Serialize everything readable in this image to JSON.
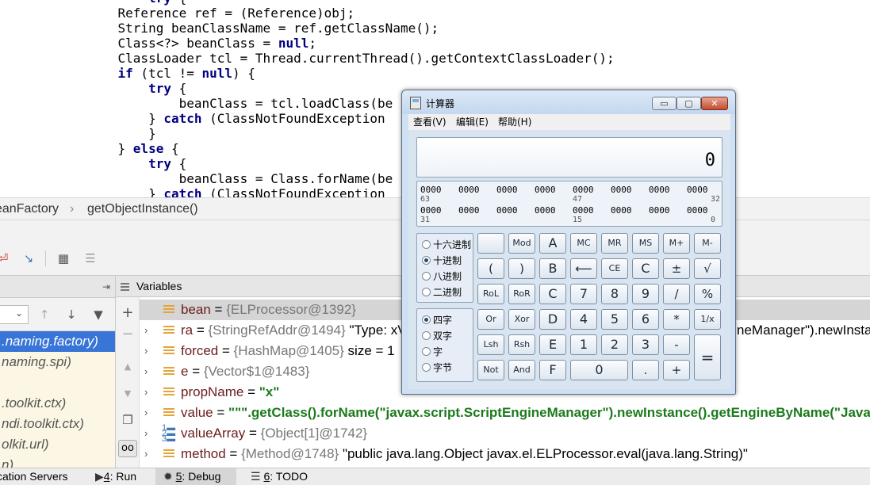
{
  "editor": {
    "lines": [
      {
        "indent": "        ",
        "kw": "try",
        "text": " {"
      },
      {
        "indent": "    ",
        "kw": "",
        "text": "Reference ref = (Reference)obj;"
      },
      {
        "indent": "    ",
        "kw": "",
        "text": "String beanClassName = ref.getClassName();"
      },
      {
        "indent": "    ",
        "kw": "",
        "text": "Class<?> beanClass = ",
        "kw2": "null",
        "tail": ";"
      },
      {
        "indent": "    ",
        "kw": "",
        "text": "ClassLoader tcl = Thread.currentThread().getContextClassLoader();"
      },
      {
        "indent": "    ",
        "kw": "if",
        "text": " (tcl != ",
        "kw2": "null",
        "tail": ") {"
      },
      {
        "indent": "        ",
        "kw": "try",
        "text": " {"
      },
      {
        "indent": "            ",
        "kw": "",
        "text": "beanClass = tcl.loadClass(be"
      },
      {
        "indent": "        ",
        "kw": "",
        "text": "} ",
        "kw2": "catch",
        "tail": " (ClassNotFoundException"
      },
      {
        "indent": "        ",
        "kw": "",
        "text": "}"
      },
      {
        "indent": "    ",
        "kw": "",
        "text": "} ",
        "kw2": "else",
        "tail": " {"
      },
      {
        "indent": "        ",
        "kw": "try",
        "text": " {"
      },
      {
        "indent": "            ",
        "kw": "",
        "text": "beanClass = Class.forName(be"
      },
      {
        "indent": "        ",
        "kw": "",
        "text": "} ",
        "kw2": "catch",
        "tail": " (ClassNotFoundException"
      }
    ]
  },
  "breadcrumb": {
    "class_name": "eanFactory",
    "separator": "›",
    "method": "getObjectInstance()"
  },
  "frames": {
    "items": [
      ".naming.factory)",
      "naming.spi)",
      "",
      ".toolkit.ctx)",
      "ndi.toolkit.ctx)",
      "olkit.url)",
      "n)"
    ],
    "selected_index": 0
  },
  "variables": {
    "header": "Variables",
    "rows": [
      {
        "name": "bean",
        "eq": " = ",
        "ref": "{ELProcessor@1392}",
        "value": "",
        "str": "",
        "expandable": false,
        "icon": "field",
        "selected": true
      },
      {
        "name": "ra",
        "eq": " = ",
        "ref": "{StringRefAddr@1494}",
        "value": " \"Type: xV",
        "str": "",
        "expandable": true,
        "icon": "field",
        "selected": false
      },
      {
        "name": "forced",
        "eq": " = ",
        "ref": "{HashMap@1405}",
        "value": "  size = 1",
        "str": "",
        "expandable": true,
        "icon": "field",
        "selected": false
      },
      {
        "name": "e",
        "eq": " = ",
        "ref": "{Vector$1@1483}",
        "value": "",
        "str": "",
        "expandable": true,
        "icon": "field",
        "selected": false
      },
      {
        "name": "propName",
        "eq": " = ",
        "ref": "",
        "value": "",
        "str": "\"x\"",
        "expandable": true,
        "icon": "field",
        "selected": false
      },
      {
        "name": "value",
        "eq": " = ",
        "ref": "",
        "value": "",
        "str": "\"\"\".getClass().forName(\"javax.script.ScriptEngineManager\").newInstance().getEngineByName(\"JavaScript",
        "expandable": true,
        "icon": "field",
        "selected": false
      },
      {
        "name": "valueArray",
        "eq": " = ",
        "ref": "{Object[1]@1742}",
        "value": "",
        "str": "",
        "expandable": true,
        "icon": "array",
        "selected": false
      },
      {
        "name": "method",
        "eq": " = ",
        "ref": "{Method@1748}",
        "value": " \"public java.lang.Object javax.el.ELProcessor.eval(java.lang.String)\"",
        "str": "",
        "expandable": true,
        "icon": "field",
        "selected": false
      }
    ],
    "overflow_text": "neManager\").newInsta"
  },
  "statusbar": {
    "items": [
      {
        "prefix": "",
        "key": "",
        "label": "cation Servers"
      },
      {
        "prefix": "",
        "key": "4",
        "label": ": Run"
      },
      {
        "prefix": "",
        "key": "5",
        "label": ": Debug"
      },
      {
        "prefix": "",
        "key": "6",
        "label": ": TODO"
      }
    ],
    "active_index": 2
  },
  "calculator": {
    "title": "计算器",
    "window_buttons": {
      "minimize": "▭",
      "maximize": "▢",
      "close": "✕"
    },
    "menu": [
      "查看(V)",
      "编辑(E)",
      "帮助(H)"
    ],
    "display": "0",
    "bits_row1": [
      "0000",
      "0000",
      "0000",
      "0000",
      "0000",
      "0000",
      "0000",
      "0000"
    ],
    "bits_row1_pos": [
      "63",
      "47",
      "32"
    ],
    "bits_row2": [
      "0000",
      "0000",
      "0000",
      "0000",
      "0000",
      "0000",
      "0000",
      "0000"
    ],
    "bits_row2_pos": [
      "31",
      "15",
      "0"
    ],
    "base_options": [
      {
        "label": "十六进制",
        "checked": false
      },
      {
        "label": "十进制",
        "checked": true
      },
      {
        "label": "八进制",
        "checked": false
      },
      {
        "label": "二进制",
        "checked": false
      }
    ],
    "word_options": [
      {
        "label": "四字",
        "checked": true
      },
      {
        "label": "双字",
        "checked": false
      },
      {
        "label": "字",
        "checked": false
      },
      {
        "label": "字节",
        "checked": false
      }
    ],
    "keys": {
      "r1": [
        "",
        "Mod",
        "A",
        "MC",
        "MR",
        "MS",
        "M+",
        "M-"
      ],
      "r2": [
        "(",
        ")",
        "B",
        "⟵",
        "CE",
        "C",
        "±",
        "√"
      ],
      "r3": [
        "RoL",
        "RoR",
        "C",
        "7",
        "8",
        "9",
        "/",
        "%"
      ],
      "r4": [
        "Or",
        "Xor",
        "D",
        "4",
        "5",
        "6",
        "*",
        "1/x"
      ],
      "r5": [
        "Lsh",
        "Rsh",
        "E",
        "1",
        "2",
        "3",
        "-",
        "="
      ],
      "r6": [
        "Not",
        "And",
        "F",
        "0",
        ".",
        "+"
      ]
    }
  }
}
